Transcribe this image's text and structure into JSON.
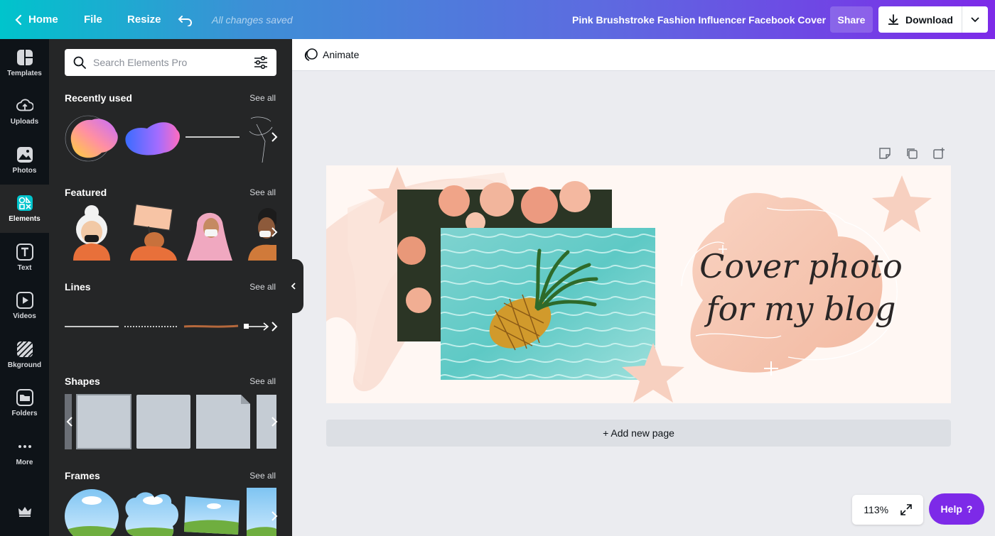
{
  "topbar": {
    "home": "Home",
    "file": "File",
    "resize": "Resize",
    "saved_status": "All changes saved",
    "doc_title": "Pink Brushstroke Fashion Influencer Facebook Cover",
    "share": "Share",
    "download": "Download"
  },
  "rail": {
    "items": [
      "Templates",
      "Uploads",
      "Photos",
      "Elements",
      "Text",
      "Videos",
      "Bkground",
      "Folders",
      "More"
    ]
  },
  "panel": {
    "search_placeholder": "Search Elements Pro",
    "see_all": "See all",
    "sections": [
      "Recently used",
      "Featured",
      "Lines",
      "Shapes",
      "Frames"
    ]
  },
  "toolbar": {
    "animate": "Animate"
  },
  "canvas": {
    "headline_line1": "Cover photo",
    "headline_line2": "for my blog"
  },
  "add_page": "+ Add new page",
  "zoom": {
    "level": "113%"
  },
  "help": {
    "label": "Help",
    "icon": "?"
  },
  "colors": {
    "accent": "#7d2ae8",
    "teal": "#00c4cc",
    "rail_bg": "#0e1318",
    "panel_bg": "#252627",
    "canvas_bg": "#fff7f3",
    "peach": "#f6c9b8"
  }
}
